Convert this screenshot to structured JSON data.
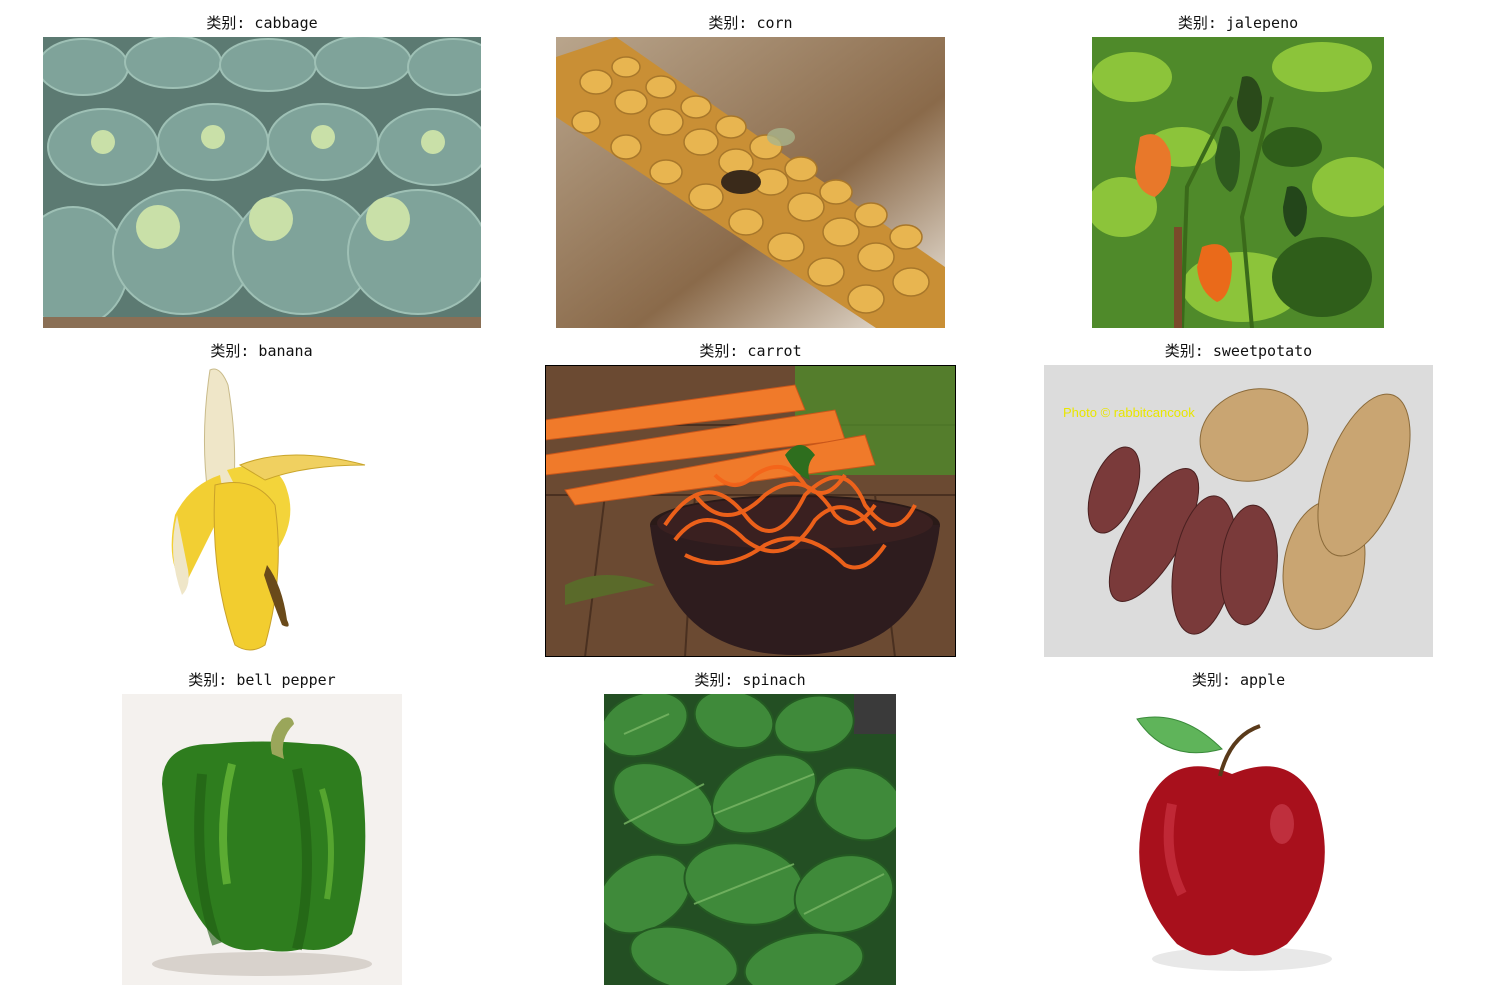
{
  "title_prefix": "类别: ",
  "panels": [
    {
      "id": "cabbage",
      "title": "类别: cabbage"
    },
    {
      "id": "corn",
      "title": "类别: corn"
    },
    {
      "id": "jalepeno",
      "title": "类别: jalepeno"
    },
    {
      "id": "banana",
      "title": "类别: banana"
    },
    {
      "id": "carrot",
      "title": "类别: carrot"
    },
    {
      "id": "sweetpotato",
      "title": "类别: sweetpotato",
      "watermark": "Photo © rabbitcancook"
    },
    {
      "id": "bellpepper",
      "title": "类别: bell pepper"
    },
    {
      "id": "spinach",
      "title": "类别: spinach"
    },
    {
      "id": "apple",
      "title": "类别: apple"
    }
  ],
  "colors": {
    "background": "#ffffff",
    "title_text": "#111111",
    "cabbage": "#6f8f86",
    "corn": "#d9a23a",
    "jalepeno_leaf": "#6aa52c",
    "banana": "#f0d040",
    "carrot": "#f06a1c",
    "sweetpotato_skin": "#7a3a3a",
    "bellpepper": "#2e7d1e",
    "spinach": "#2f6e2f",
    "apple": "#b01020"
  }
}
